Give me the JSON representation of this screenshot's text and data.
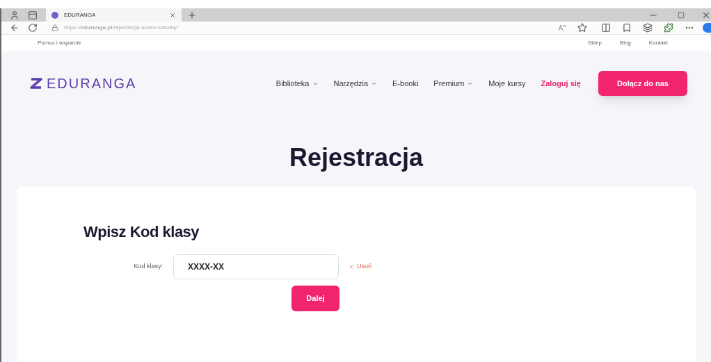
{
  "browser": {
    "tab_title": "EDURANGA",
    "url": "https://**eduranga.pl**/rejestracja-uczen-szkolny/"
  },
  "topbar": {
    "left": "Pomoc i wsparcie",
    "right": [
      "Sklep",
      "Blog",
      "Kontakt"
    ]
  },
  "logo": "EDURANGA",
  "nav": [
    {
      "label": "Biblioteka",
      "kind": "dropdown"
    },
    {
      "label": "Narzędzia",
      "kind": "dropdown"
    },
    {
      "label": "E-booki",
      "kind": "link"
    },
    {
      "label": "Premium",
      "kind": "dropdown"
    },
    {
      "label": "Moje kursy",
      "kind": "link"
    },
    {
      "label": "Zaloguj się",
      "kind": "login"
    }
  ],
  "cta": "Dołącz do nas",
  "title": "Rejestracja",
  "form": {
    "heading": "Wpisz Kod klasy",
    "label": "Kod klasy:",
    "value": "XXXX-XX",
    "clear": "Usuń",
    "submit": "Dalej"
  }
}
